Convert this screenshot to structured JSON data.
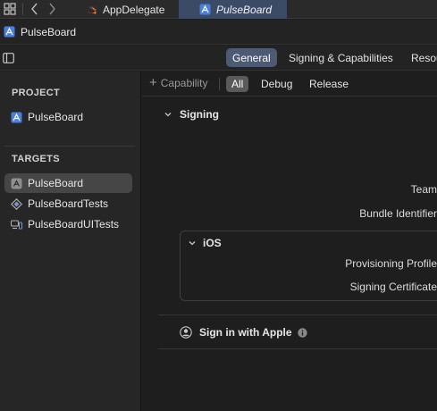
{
  "tabs": [
    {
      "label": "AppDelegate",
      "icon": "swift-file-icon",
      "active": false
    },
    {
      "label": "PulseBoard",
      "icon": "xcode-project-icon",
      "active": true
    }
  ],
  "project_header": {
    "title": "PulseBoard",
    "icon": "xcode-project-icon"
  },
  "editor_tabs": [
    {
      "label": "General",
      "selected": true
    },
    {
      "label": "Signing & Capabilities",
      "selected": false
    },
    {
      "label": "Resou",
      "selected": false
    }
  ],
  "sidebar": {
    "project_heading": "PROJECT",
    "project_items": [
      {
        "label": "PulseBoard",
        "icon": "xcode-project-icon"
      }
    ],
    "targets_heading": "TARGETS",
    "target_items": [
      {
        "label": "PulseBoard",
        "icon": "app-target-icon",
        "selected": true
      },
      {
        "label": "PulseBoardTests",
        "icon": "test-target-icon",
        "selected": false
      },
      {
        "label": "PulseBoardUITests",
        "icon": "uitest-target-icon",
        "selected": false
      }
    ]
  },
  "capabilities_bar": {
    "add_capability": "+ Capability",
    "add_capability_text": "Capability",
    "filters": [
      {
        "label": "All",
        "selected": true
      },
      {
        "label": "Debug",
        "selected": false
      },
      {
        "label": "Release",
        "selected": false
      }
    ]
  },
  "signing": {
    "title": "Signing",
    "team_label": "Team",
    "bundle_identifier_label": "Bundle Identifier",
    "ios": {
      "title": "iOS",
      "provisioning_profile_label": "Provisioning Profile",
      "signing_certificate_label": "Signing Certificate"
    }
  },
  "sign_in_with_apple": {
    "title": "Sign in with Apple"
  },
  "colors": {
    "accent": "#4c5a73",
    "active_tab": "#3b4b66",
    "swift_orange": "#f0793a",
    "xcode_blue": "#4a7fe0"
  }
}
